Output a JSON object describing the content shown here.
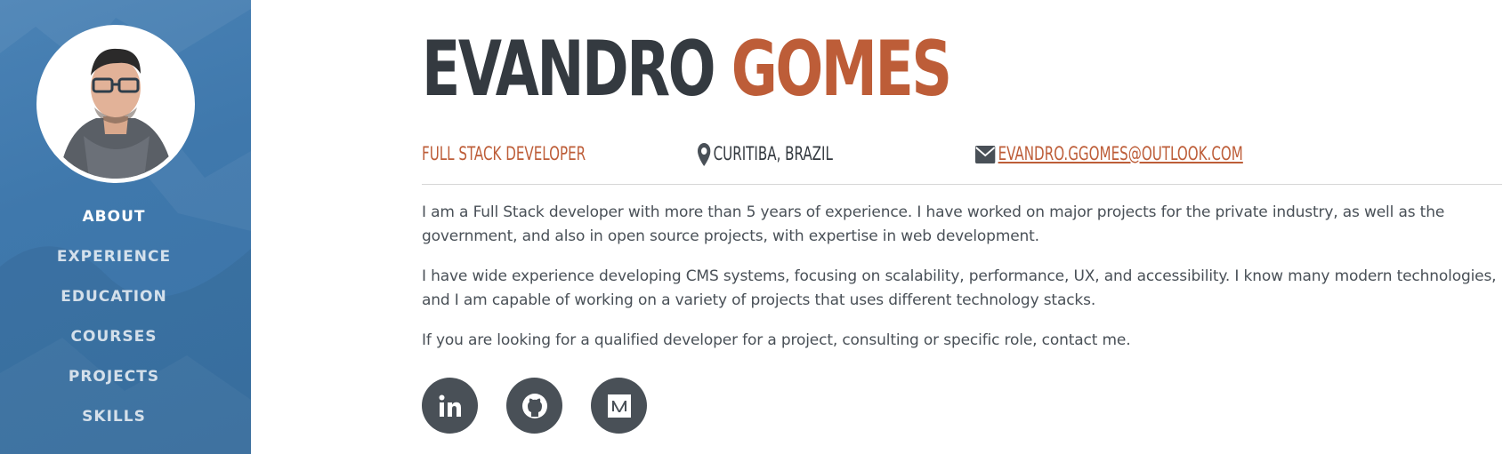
{
  "profile": {
    "first_name": "EVANDRO",
    "last_name": "GOMES",
    "role": "FULL STACK DEVELOPER",
    "location": "CURITIBA, BRAZIL",
    "email": "EVANDRO.GGOMES@OUTLOOK.COM"
  },
  "nav": {
    "items": [
      {
        "label": "ABOUT",
        "active": true
      },
      {
        "label": "EXPERIENCE",
        "active": false
      },
      {
        "label": "EDUCATION",
        "active": false
      },
      {
        "label": "COURSES",
        "active": false
      },
      {
        "label": "PROJECTS",
        "active": false
      },
      {
        "label": "SKILLS",
        "active": false
      }
    ]
  },
  "about": {
    "paragraphs": [
      "I am a Full Stack developer with more than 5 years of experience. I have worked on major projects for the private industry, as well as the government, and also in open source projects, with expertise in web development.",
      "I have wide experience developing CMS systems, focusing on scalability, performance, UX, and accessibility. I know many modern technologies, and I am capable of working on a variety of projects that uses different technology stacks.",
      "If you are looking for a qualified developer for a project, consulting or specific role, contact me."
    ]
  },
  "social": [
    {
      "icon": "linkedin-icon"
    },
    {
      "icon": "github-icon"
    },
    {
      "icon": "medium-icon"
    }
  ],
  "colors": {
    "sidebar": "#3f78ac",
    "accent": "#bd5d38",
    "dark": "#343a40",
    "text": "#495057"
  }
}
